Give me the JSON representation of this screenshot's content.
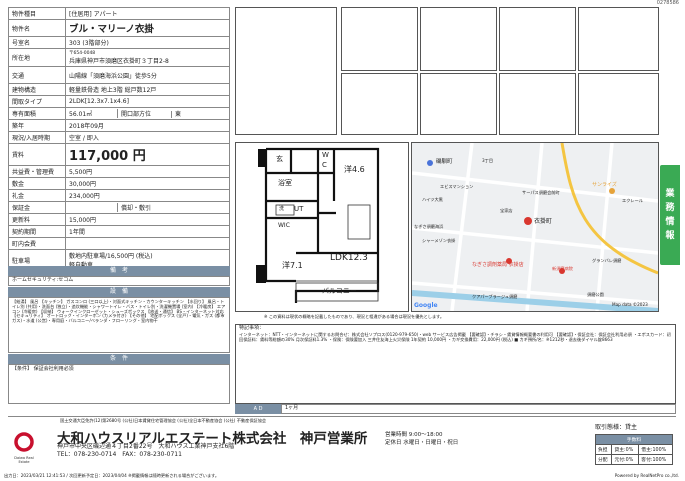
{
  "page_id": "0278586",
  "property": {
    "rows": [
      {
        "k": "物件種目",
        "v": "[住居用] アパート"
      },
      {
        "k": "物件名",
        "v": "ブル・マリーノ衣掛"
      },
      {
        "k": "号室名",
        "v": "303 (3階部分)"
      },
      {
        "k": "所在地",
        "v": "〒654-0048",
        "v2": "兵庫県神戸市須磨区衣掛町３丁目2-8"
      },
      {
        "k": "交通",
        "v": "山陽線「須磨海浜公園」徒歩5分"
      },
      {
        "k": "建物構造",
        "v": "軽量鉄骨造 地上3階 総戸数12戸"
      },
      {
        "k": "間取タイプ",
        "v": "2LDK[12.3x7.1x4.6]"
      },
      {
        "k": "専有面積",
        "v": "56.01㎡",
        "v_mid": "開口部方位",
        "v_end": "東"
      },
      {
        "k": "築年",
        "v": "2018年09月"
      },
      {
        "k": "現況/入居時期",
        "v": "空室 / 即入"
      },
      {
        "k": "賃料",
        "v": "117,000 円"
      },
      {
        "k": "共益費・管理費",
        "v": "5,500円"
      },
      {
        "k": "敷金",
        "v": "30,000円"
      },
      {
        "k": "礼金",
        "v": "234,000円"
      },
      {
        "k": "保証金",
        "v": "",
        "v_mid": "償却・敷引"
      },
      {
        "k": "更新料",
        "v": "15,000円"
      },
      {
        "k": "契約期間",
        "v": "1年間"
      },
      {
        "k": "町内会費",
        "v": ""
      },
      {
        "k": "駐車場",
        "v": "敷地内駐車場/16,500円 (税込)",
        "v2": "軽自動車"
      }
    ]
  },
  "sections": {
    "biko": "備　考",
    "biko_text": "ホームセキュリティ:セコム",
    "setsubi": "設　備",
    "setsubi_text": "【給湯】 風呂 【キッチン】 ガスコンロ (三口以上)・対面式キッチン・カウンターキッチン 【水回り】 風呂・トイレ別 (共用)・洗面台 (独立)・追炊機能・シャワートイレ・バス・トイレ別・洗濯機置場 (室内) 【冷暖房】 エアコン (冷暖房) 【収納】 ウォークインクローゼット・シューズボックス 【放送・通信】 BS・インターネット対応 【セキュリティ】 オートロック・インターホン (カメラ付き) 【その他】 宅配ボックス (全戸)・電気・ガス (都市ガス)・水道 (公営)・専用庭・バルコニー/ベランダ・フローリング・室内物干",
    "joken": "条　件",
    "joken_text": "【条件】 保証会社利用必須"
  },
  "plan": {
    "rooms": [
      "玄",
      "W",
      "C",
      "洋4.6",
      "浴室",
      "UT",
      "WIC",
      "洋7.1",
      "LDK12.3",
      "バルコニー",
      "洗"
    ]
  },
  "map": {
    "labels": [
      "磯馴町",
      "3丁目",
      "2",
      "エビスマンション",
      "ハイツ大黒",
      "なぎさ須磨海浜",
      "シャーメゾン衣掛",
      "サーパス須磨会前町",
      "宝家店",
      "衣掛町",
      "なぎさ調剤薬局 衣掛店",
      "新須磨病院",
      "サンライズ",
      "エクレール",
      "グランバレ須磨",
      "須磨公園",
      "2丁目",
      "1",
      "1",
      "2",
      "2",
      "クアパーブラージュ須磨",
      "Map data ©2023",
      "Google",
      "ピースフルハウス",
      "なし須磨",
      "ヤーバ",
      "ホソイ",
      "サンセル",
      "Aprio須磨",
      "ヤマモトアンナ"
    ],
    "caption": "※ この資料は現状の概略を記載したものであり、現況と相違がある場合は現況を優先とします。"
  },
  "notes": {
    "heading": "特記事項：",
    "text": "インターネット：NTT・インターネットに関するお問合せ：株式会社ソプロス(0120-979-650)・web サービス広告掲載 【要確認】・チラシ・賃貸情報概要書の利用可 【要確認】・保証会社：保証会社利用必須 ・エポスカード：初回保証料：賃料等総額の30% 月次保証料1.3% ・保険：保険要加入 三井住友海上火災保険 1年契約 10,000円 ・カギ交換費用：22,000円 (税込) ■ カギ預所/名：※1212秒・退去後ダイヤル錠8663",
    "ad_label": "A D",
    "ad_value": "1ヶ月"
  },
  "company": {
    "license": "国土交通大臣免許(12)第2680号 (公社)日本賃貸住宅管理協会 (公社)全日本不動産協会 (公社) 不動産保証協会",
    "name": "大和ハウスリアルエステート株式会社　神戸営業所",
    "address": "神戸市中央区磯辺通４丁目2番22号　大和ハウス工業神戸支社6階",
    "tel": "TEL：078-230-0714　FAX：078-230-0711",
    "hours": "営業時間 9:00～18:00",
    "holiday": "定休日 水曜日・日曜日・祝日",
    "logo_text": "Daiwa Real Estate",
    "transaction_label": "取引態様：貸主",
    "fee_label": "手数料",
    "fee_rows": [
      {
        "a": "負担",
        "b": "貸主:0%",
        "c": "借主:100%"
      },
      {
        "a": "分配",
        "b": "元付:0%",
        "c": "客付:100%"
      }
    ]
  },
  "bottom": {
    "left": "出力日：2023/03/21 12:41:53 / 次回更新予定日：2023/04/04 ※掲載情報は随時更新される場合がございます。",
    "right": "Powered by RealNetPro co.,ltd."
  },
  "side_tab": [
    "業",
    "務",
    "情",
    "報"
  ],
  "colors": {
    "accent": "#3aaa54",
    "section_head": "#7a8fa4",
    "logo_red": "#c8102e"
  }
}
